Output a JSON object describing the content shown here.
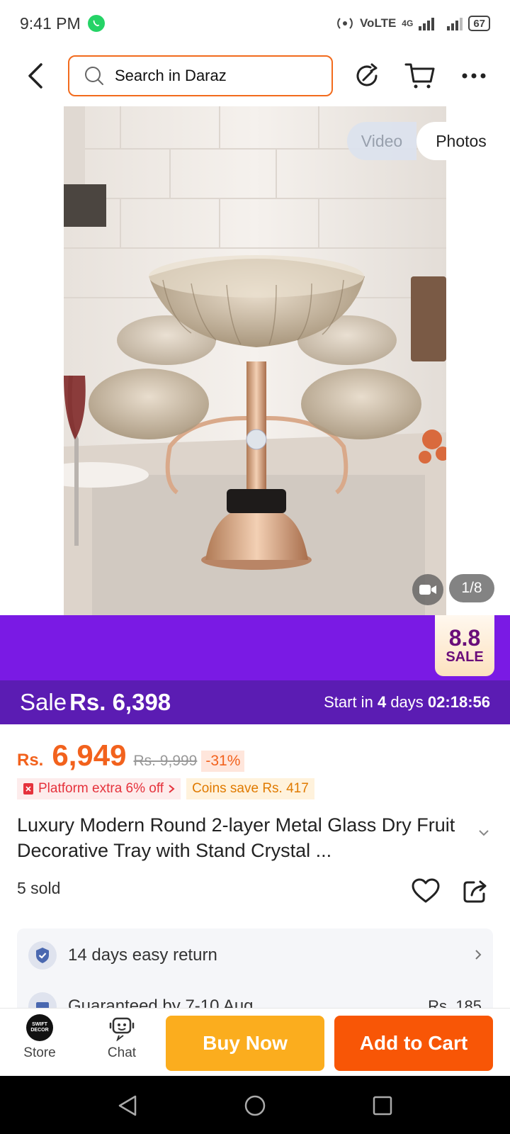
{
  "status_bar": {
    "time": "9:41 PM",
    "network": "VoLTE",
    "net_type": "4G",
    "battery": "67",
    "icons": [
      "whatsapp-icon",
      "hotspot-icon",
      "signal-icon",
      "battery-icon"
    ]
  },
  "nav": {
    "search_placeholder": "Search in Daraz",
    "icons": [
      "back-icon",
      "search-icon",
      "share-icon",
      "cart-icon",
      "more-icon"
    ]
  },
  "gallery": {
    "tab_video": "Video",
    "tab_photos": "Photos",
    "active_tab": "Photos",
    "counter": "1/8",
    "image_subject": "gold glass dry fruit tray with stand"
  },
  "sale_badge": {
    "big": "8.8",
    "small": "SALE"
  },
  "sale_strip": {
    "label": "Sale",
    "price": "Rs. 6,398",
    "start_prefix": "Start in",
    "days_num": "4",
    "days_word": "days",
    "countdown": "02:18:56"
  },
  "price": {
    "currency": "Rs.",
    "value": "6,949",
    "original": "Rs. 9,999",
    "discount": "-31%"
  },
  "promos": {
    "platform": "Platform extra 6% off",
    "coins": "Coins save Rs. 417"
  },
  "product": {
    "title": "Luxury Modern Round 2-layer Metal Glass Dry Fruit Decorative Tray with Stand Crystal ...",
    "sold": "5 sold"
  },
  "services": {
    "return_text": "14 days easy return",
    "delivery_text": "Guaranteed by 7-10 Aug",
    "delivery_fee": "Rs. 185"
  },
  "bottom_bar": {
    "store_label": "Store",
    "store_logo_line1": "SWIFT",
    "store_logo_line2": "DECOR",
    "chat_label": "Chat",
    "buy_now": "Buy Now",
    "add_to_cart": "Add to Cart"
  },
  "colors": {
    "brand_orange": "#f85606",
    "buy_yellow": "#fbad1e",
    "sale_purple": "#7a1ae4",
    "sale_strip_purple": "#5b1cb3",
    "price_orange": "#f2621d"
  }
}
